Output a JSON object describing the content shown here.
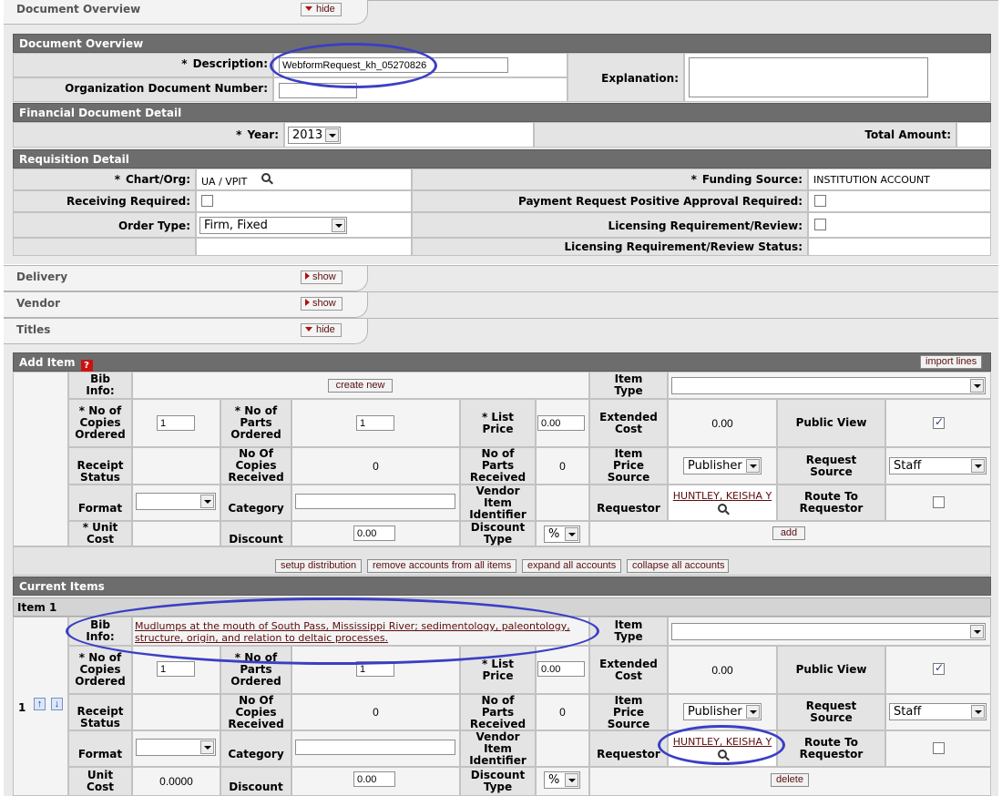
{
  "tabs": {
    "document_overview": {
      "title": "Document Overview",
      "toggle": "hide"
    },
    "delivery": {
      "title": "Delivery",
      "toggle": "show"
    },
    "vendor": {
      "title": "Vendor",
      "toggle": "show"
    },
    "titles": {
      "title": "Titles",
      "toggle": "hide"
    }
  },
  "doc_overview": {
    "header": "Document Overview",
    "description_label": "Description:",
    "description_value": "WebformRequest_kh_05270826",
    "org_doc_number_label": "Organization Document Number:",
    "org_doc_number_value": "",
    "explanation_label": "Explanation:",
    "explanation_value": ""
  },
  "financial": {
    "header": "Financial Document Detail",
    "year_label": "Year:",
    "year_value": "2013",
    "total_amount_label": "Total Amount:",
    "total_amount_value": ""
  },
  "requisition": {
    "header": "Requisition Detail",
    "chart_org_label": "Chart/Org:",
    "chart_org_value": "UA  /  VPIT",
    "funding_source_label": "Funding Source:",
    "funding_source_value": "INSTITUTION ACCOUNT",
    "receiving_required_label": "Receiving Required:",
    "payment_request_label": "Payment Request Positive Approval Required:",
    "order_type_label": "Order Type:",
    "order_type_value": "Firm, Fixed",
    "licensing_label": "Licensing Requirement/Review:",
    "licensing_status_label": "Licensing Requirement/Review Status:"
  },
  "add_item": {
    "header": "Add Item",
    "help_glyph": "?",
    "import_lines": "import lines",
    "bib_info_label": "Bib Info:",
    "create_new": "create new",
    "item_type_label": "Item Type",
    "copies_ordered_label": "No of Copies Ordered",
    "copies_ordered_value": "1",
    "parts_ordered_label": "No of Parts Ordered",
    "parts_ordered_value": "1",
    "list_price_label": "List Price",
    "list_price_value": "0.00",
    "extended_cost_label": "Extended Cost",
    "extended_cost_value": "0.00",
    "public_view_label": "Public View",
    "receipt_status_label": "Receipt Status",
    "copies_received_label": "No Of Copies Received",
    "copies_received_value": "0",
    "parts_received_label": "No of Parts Received",
    "parts_received_value": "0",
    "item_price_source_label": "Item Price Source",
    "item_price_source_value": "Publisher",
    "request_source_label": "Request Source",
    "request_source_value": "Staff",
    "format_label": "Format",
    "category_label": "Category",
    "vendor_item_id_label": "Vendor Item Identifier",
    "requestor_label": "Requestor",
    "requestor_value": "HUNTLEY, KEISHA Y",
    "route_to_requestor_label": "Route To Requestor",
    "unit_cost_label": "Unit Cost",
    "discount_label": "Discount",
    "discount_value": "0.00",
    "discount_type_label": "Discount Type",
    "discount_type_value": "%",
    "add_button": "add"
  },
  "actions": {
    "setup_distribution": "setup distribution",
    "remove_accounts": "remove accounts from all items",
    "expand_accounts": "expand all accounts",
    "collapse_accounts": "collapse all accounts"
  },
  "current_items": {
    "header": "Current Items",
    "item_header": "Item 1",
    "row_number": "1",
    "up_glyph": "↑",
    "down_glyph": "↓",
    "bib_info_label": "Bib Info:",
    "bib_info_line1": "Mudlumps at the mouth of South Pass, Mississippi River; sedimentology, paleontology,",
    "bib_info_line2": "structure, origin, and relation to deltaic processes.",
    "item_type_label": "Item Type",
    "copies_ordered_label": "No of Copies Ordered",
    "copies_ordered_value": "1",
    "parts_ordered_label": "No of Parts Ordered",
    "parts_ordered_value": "1",
    "list_price_label": "List Price",
    "list_price_value": "0.00",
    "extended_cost_label": "Extended Cost",
    "extended_cost_value": "0.00",
    "public_view_label": "Public View",
    "receipt_status_label": "Receipt Status",
    "copies_received_label": "No Of Copies Received",
    "copies_received_value": "0",
    "parts_received_label": "No of Parts Received",
    "parts_received_value": "0",
    "item_price_source_label": "Item Price Source",
    "item_price_source_value": "Publisher",
    "request_source_label": "Request Source",
    "request_source_value": "Staff",
    "format_label": "Format",
    "category_label": "Category",
    "vendor_item_id_label": "Vendor Item Identifier",
    "requestor_label": "Requestor",
    "requestor_value": "HUNTLEY, KEISHA Y",
    "route_to_requestor_label": "Route To Requestor",
    "unit_cost_label": "Unit Cost",
    "unit_cost_value": "0.0000",
    "discount_label": "Discount",
    "discount_value": "0.00",
    "discount_type_label": "Discount Type",
    "discount_type_value": "%",
    "delete_button": "delete"
  },
  "required_marker": "*",
  "colors": {
    "header_bar": "#6d6d6d",
    "subheader": "#d4d4d4",
    "label_cell": "#e4e4e4",
    "annotation_oval": "#3a3fc4",
    "button_text": "#5a0e0e"
  }
}
